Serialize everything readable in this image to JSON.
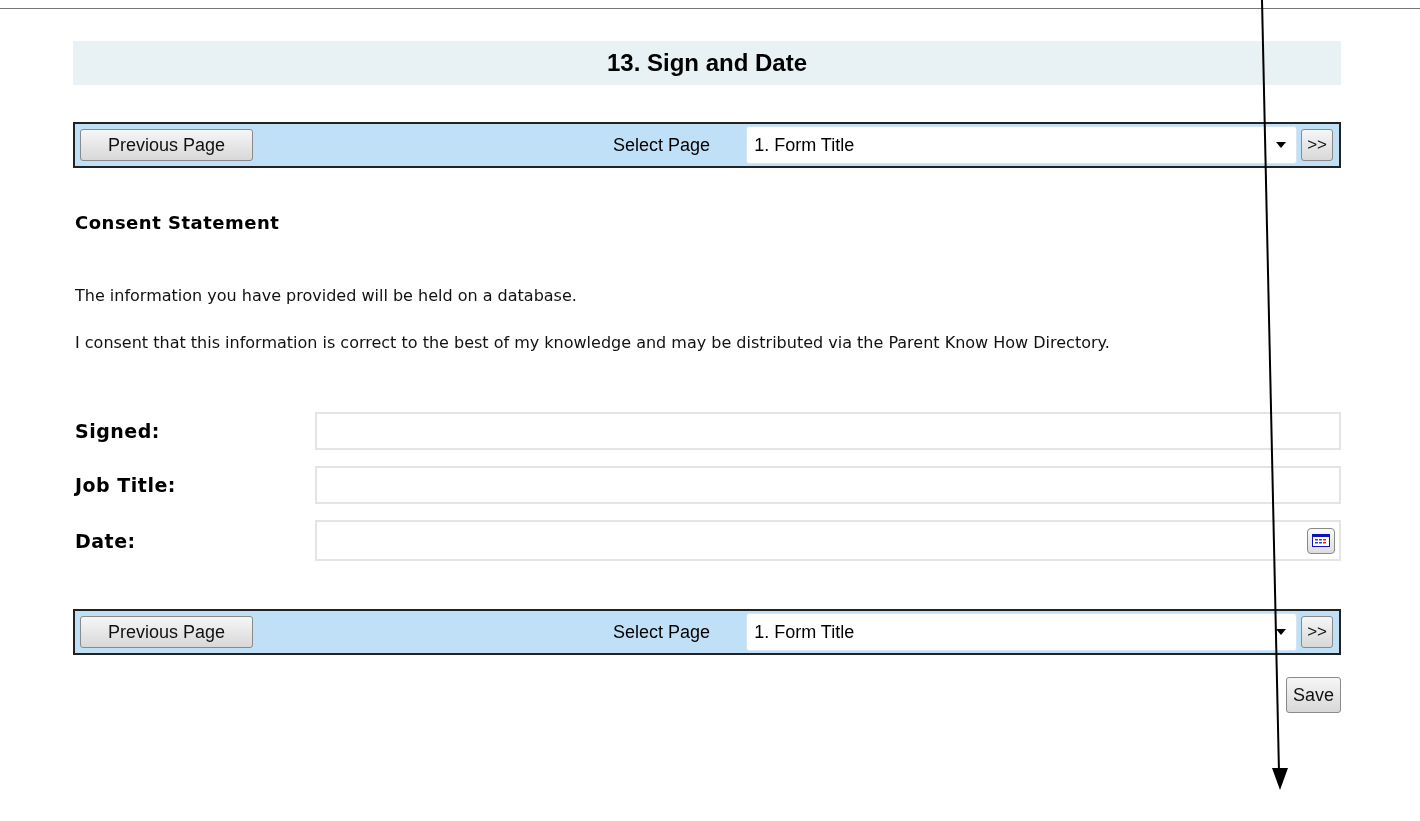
{
  "title": "13. Sign and Date",
  "nav_bars": [
    {
      "previous_button": "Previous Page",
      "select_label": "Select Page",
      "select_value": "1. Form Title",
      "next_button": ">>"
    },
    {
      "previous_button": "Previous Page",
      "select_label": "Select Page",
      "select_value": "1. Form Title",
      "next_button": ">>"
    }
  ],
  "section_heading": "Consent Statement",
  "paragraphs": [
    "The information you have provided will be held on a database.",
    "I consent that this information is correct to the best of my knowledge and may be distributed via the Parent Know How Directory."
  ],
  "fields": [
    {
      "label": "Signed:",
      "kind": "text"
    },
    {
      "label": "Job Title:",
      "kind": "text"
    },
    {
      "label": "Date:",
      "kind": "date"
    }
  ],
  "save_button": "Save"
}
